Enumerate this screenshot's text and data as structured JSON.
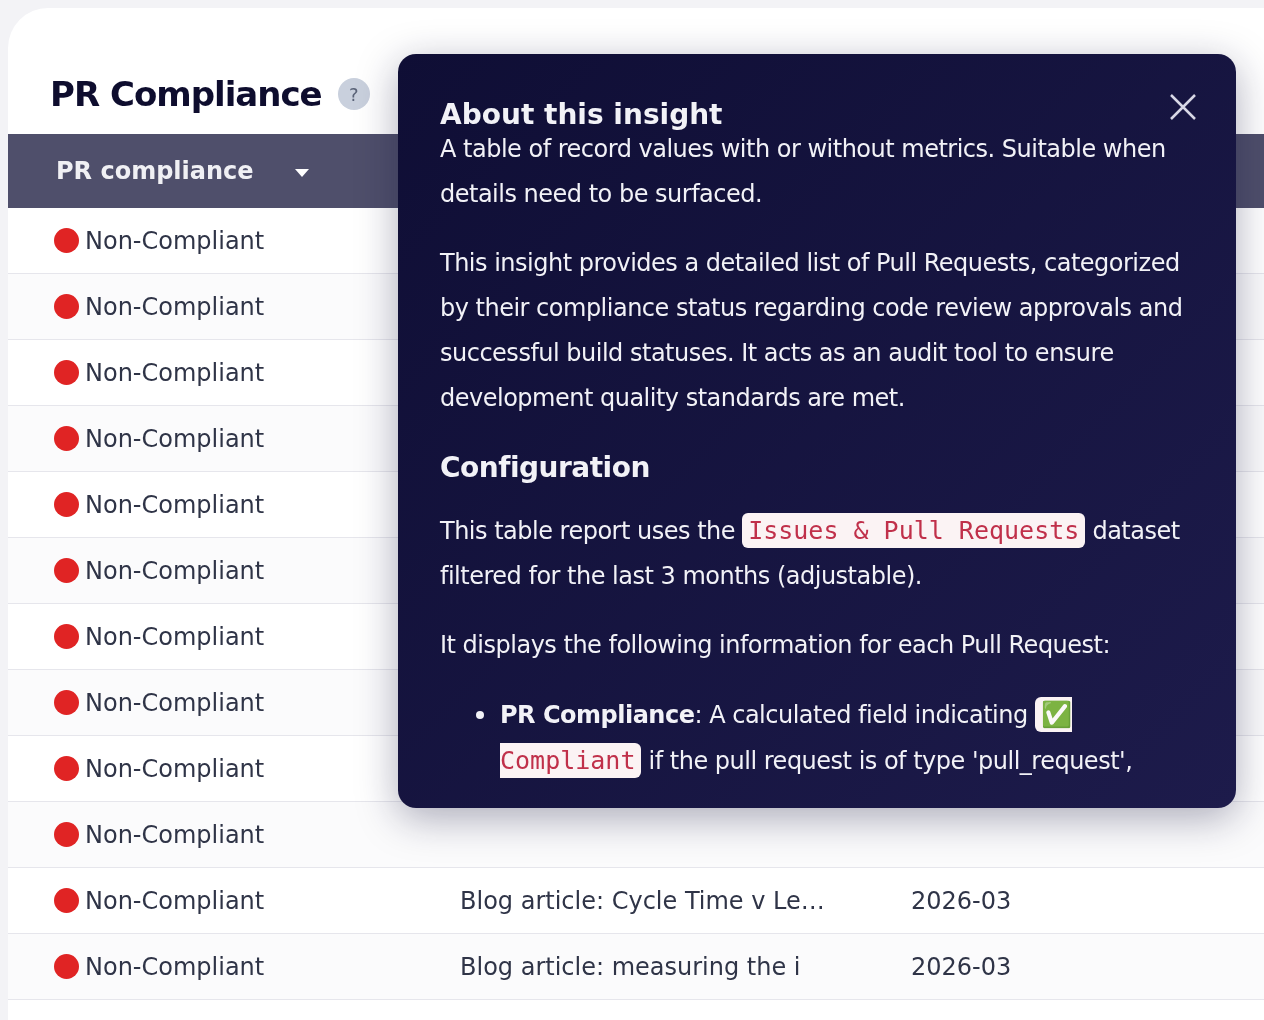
{
  "title": "PR Compliance",
  "help_glyph": "?",
  "table": {
    "columns": [
      {
        "label": "PR compliance",
        "sortable": true
      }
    ],
    "rows": [
      {
        "status": "Non-Compliant",
        "color": "#e02424"
      },
      {
        "status": "Non-Compliant",
        "color": "#e02424"
      },
      {
        "status": "Non-Compliant",
        "color": "#e02424"
      },
      {
        "status": "Non-Compliant",
        "color": "#e02424"
      },
      {
        "status": "Non-Compliant",
        "color": "#e02424"
      },
      {
        "status": "Non-Compliant",
        "color": "#e02424"
      },
      {
        "status": "Non-Compliant",
        "color": "#e02424"
      },
      {
        "status": "Non-Compliant",
        "color": "#e02424"
      },
      {
        "status": "Non-Compliant",
        "color": "#e02424"
      },
      {
        "status": "Non-Compliant",
        "color": "#e02424"
      },
      {
        "status": "Non-Compliant",
        "color": "#e02424",
        "title": "Blog article: Cycle Time v Le…",
        "month": "2026-03"
      },
      {
        "status": "Non-Compliant",
        "color": "#e02424",
        "title": "Blog article: measuring the i",
        "month": "2026-03"
      }
    ]
  },
  "popover": {
    "title": "About this insight",
    "blocks": [
      {
        "kind": "lead",
        "parts": [
          {
            "kind": "text",
            "text": "A table of record values with or without metrics. Suitable when details need to be surfaced."
          }
        ]
      },
      {
        "kind": "para",
        "parts": [
          {
            "kind": "text",
            "text": "This insight provides a detailed list of Pull Requests, categorized by their compliance status regarding code review approvals and successful build statuses. It acts as an audit tool to ensure development quality standards are met."
          }
        ]
      },
      {
        "kind": "heading",
        "parts": [
          {
            "kind": "text",
            "text": "Configuration"
          }
        ]
      },
      {
        "kind": "para",
        "parts": [
          {
            "kind": "text",
            "text": "This table report uses the "
          },
          {
            "kind": "code",
            "text": "Issues & Pull Requests"
          },
          {
            "kind": "text",
            "text": " dataset filtered for the last 3 months (adjustable)."
          }
        ]
      },
      {
        "kind": "para",
        "parts": [
          {
            "kind": "text",
            "text": "It displays the following information for each Pull Request:"
          }
        ]
      },
      {
        "kind": "bullet",
        "parts": [
          {
            "kind": "bold",
            "text": "PR Compliance"
          },
          {
            "kind": "text",
            "text": ": A calculated field indicating "
          },
          {
            "kind": "code",
            "text": "✅ Compliant"
          },
          {
            "kind": "text",
            "text": " if the pull request is of type 'pull_request',"
          }
        ]
      }
    ]
  }
}
